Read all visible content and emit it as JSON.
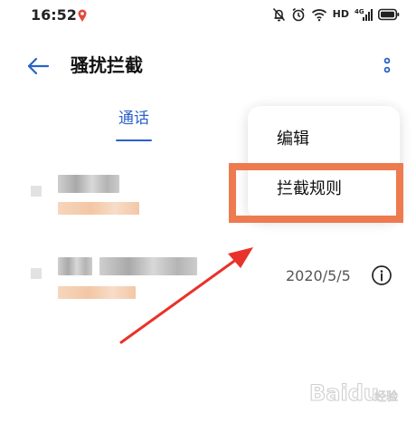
{
  "status_bar": {
    "time": "16:52",
    "network_label": "HD",
    "icons": [
      "location-pin-icon",
      "mute-icon",
      "alarm-icon",
      "wifi-icon",
      "signal-icon",
      "battery-icon"
    ]
  },
  "header": {
    "title": "骚扰拦截",
    "icons": [
      "back-arrow-icon",
      "more-vertical-icon"
    ]
  },
  "tabs": [
    {
      "label": "通话",
      "active": true
    }
  ],
  "call_list": [
    {
      "name": "",
      "detail": "",
      "date": ""
    },
    {
      "name": "",
      "detail": "",
      "date": "2020/5/5"
    }
  ],
  "menu": {
    "items": [
      {
        "label": "编辑"
      },
      {
        "label": "拦截规则",
        "highlighted": true
      }
    ]
  },
  "colors": {
    "accent": "#2a62c9",
    "highlight": "#ee7a4f",
    "arrow": "#e8332a"
  },
  "watermark": {
    "brand": "Baidu",
    "sub": "经验"
  }
}
